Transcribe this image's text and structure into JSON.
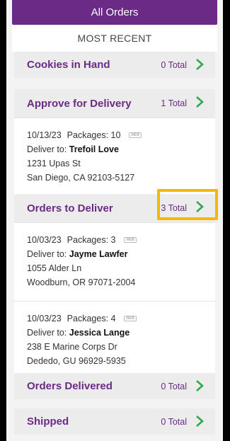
{
  "header": {
    "title": "All Orders",
    "subtitle": "MOST RECENT"
  },
  "sections": {
    "cookies": {
      "title": "Cookies in Hand",
      "count": "0 Total"
    },
    "approve": {
      "title": "Approve for Delivery",
      "count": "1 Total",
      "orders": [
        {
          "date": "10/13/23",
          "packages": "Packages: 10",
          "badge": "WEB",
          "deliver_label": "Deliver to:",
          "name": "Trefoil Love",
          "street": "1231 Upas St",
          "city": "San Diego, CA 92103-5127"
        }
      ]
    },
    "deliver": {
      "title": "Orders to Deliver",
      "count": "3 Total",
      "orders": [
        {
          "date": "10/03/23",
          "packages": "Packages: 3",
          "badge": "WEB",
          "deliver_label": "Deliver to:",
          "name": "Jayme Lawfer",
          "street": "1055 Alder Ln",
          "city": "Woodburn, OR 97071-2004"
        },
        {
          "date": "10/03/23",
          "packages": "Packages: 4",
          "badge": "WEB",
          "deliver_label": "Deliver to:",
          "name": "Jessica Lange",
          "street": "238 E Marine Corps Dr",
          "city": "Dededo, GU 96929-5935"
        }
      ]
    },
    "delivered": {
      "title": "Orders Delivered",
      "count": "0 Total"
    },
    "shipped": {
      "title": "Shipped",
      "count": "0 Total"
    }
  },
  "colors": {
    "brand": "#6b2a86",
    "accent_green": "#2aa84a",
    "highlight": "#f5b800"
  }
}
